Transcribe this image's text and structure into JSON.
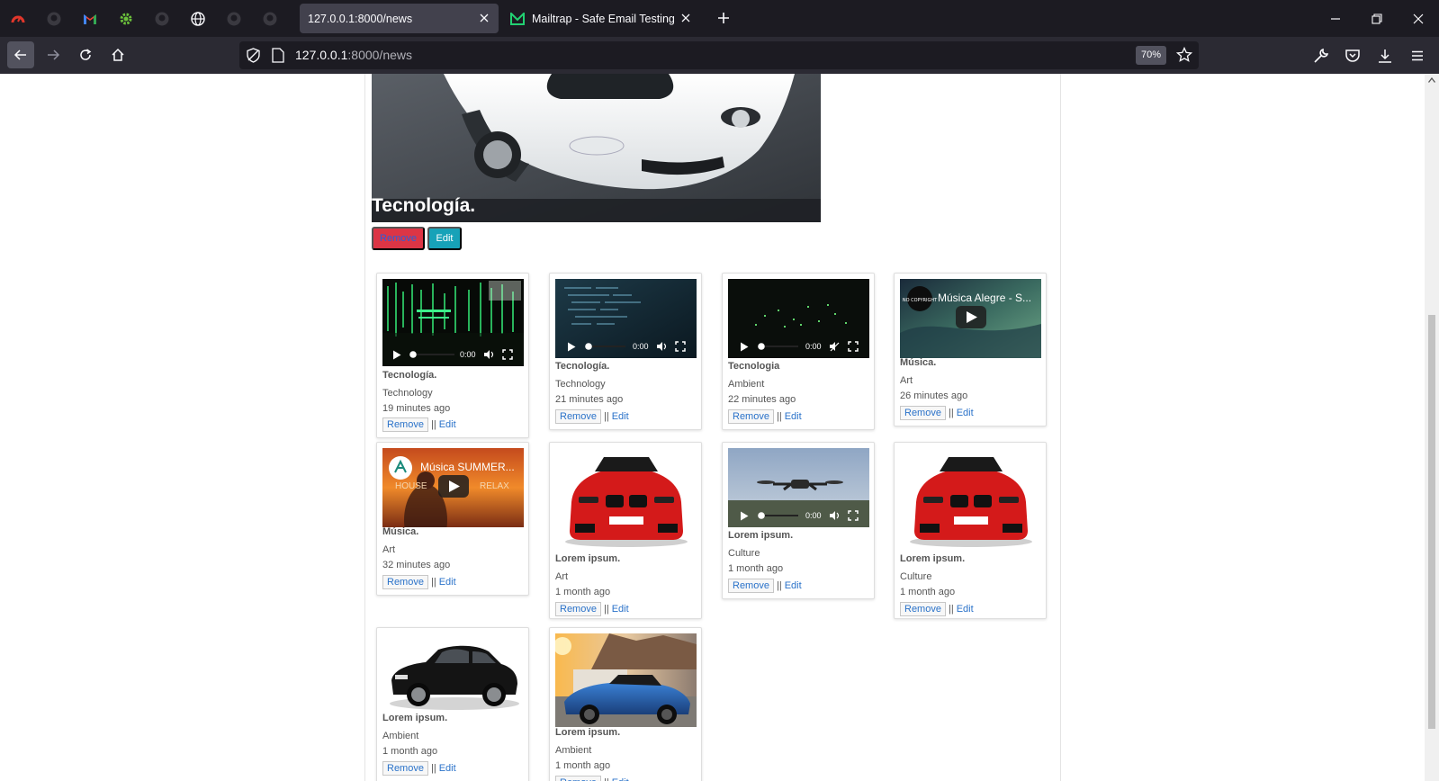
{
  "browser": {
    "tabs": [
      {
        "title": "127.0.0.1:8000/news",
        "active": true
      },
      {
        "title": "Mailtrap - Safe Email Testing",
        "active": false
      }
    ],
    "url": {
      "host": "127.0.0.1",
      "rest": ":8000/news"
    },
    "zoom": "70%",
    "pinned_icons": [
      "speedometer-icon",
      "github-icon",
      "gmail-icon",
      "settings-gear-icon",
      "github-icon",
      "globe-icon",
      "github-icon",
      "github-icon"
    ],
    "colors": {
      "tabbar": "#1c1b22",
      "navbar": "#2b2a33",
      "active_tab": "#42414d"
    }
  },
  "hero": {
    "title": "Tecnología.",
    "remove_label": "Remove",
    "edit_label": "Edit"
  },
  "cards": [
    {
      "title": "Tecnología.",
      "category": "Technology",
      "time": "19 minutes ago",
      "media": "video",
      "video_time": "0:00"
    },
    {
      "title": "Tecnología.",
      "category": "Technology",
      "time": "21 minutes ago",
      "media": "video",
      "video_time": "0:00"
    },
    {
      "title": "Tecnologia",
      "category": "Ambient",
      "time": "22 minutes ago",
      "media": "video",
      "video_time": "0:00"
    },
    {
      "title": "Música.",
      "category": "Art",
      "time": "26 minutes ago",
      "media": "youtube",
      "yt_title": "Música Alegre - S..."
    },
    {
      "title": "Música.",
      "category": "Art",
      "time": "32 minutes ago",
      "media": "youtube",
      "yt_title": "Música SUMMER...",
      "yt_words": [
        "HOUSE",
        "RELAX"
      ]
    },
    {
      "title": "Lorem ipsum.",
      "category": "Art",
      "time": "1 month ago",
      "media": "image-red-car"
    },
    {
      "title": "Lorem ipsum.",
      "category": "Culture",
      "time": "1 month ago",
      "media": "video",
      "video_time": "0:00"
    },
    {
      "title": "Lorem ipsum.",
      "category": "Culture",
      "time": "1 month ago",
      "media": "image-red-car"
    },
    {
      "title": "Lorem ipsum.",
      "category": "Ambient",
      "time": "1 month ago",
      "media": "image-black-car"
    },
    {
      "title": "Lorem ipsum.",
      "category": "Ambient",
      "time": "1 month ago",
      "media": "image-blue-car"
    }
  ],
  "card_actions": {
    "remove_label": "Remove",
    "separator": "||",
    "edit_label": "Edit"
  }
}
